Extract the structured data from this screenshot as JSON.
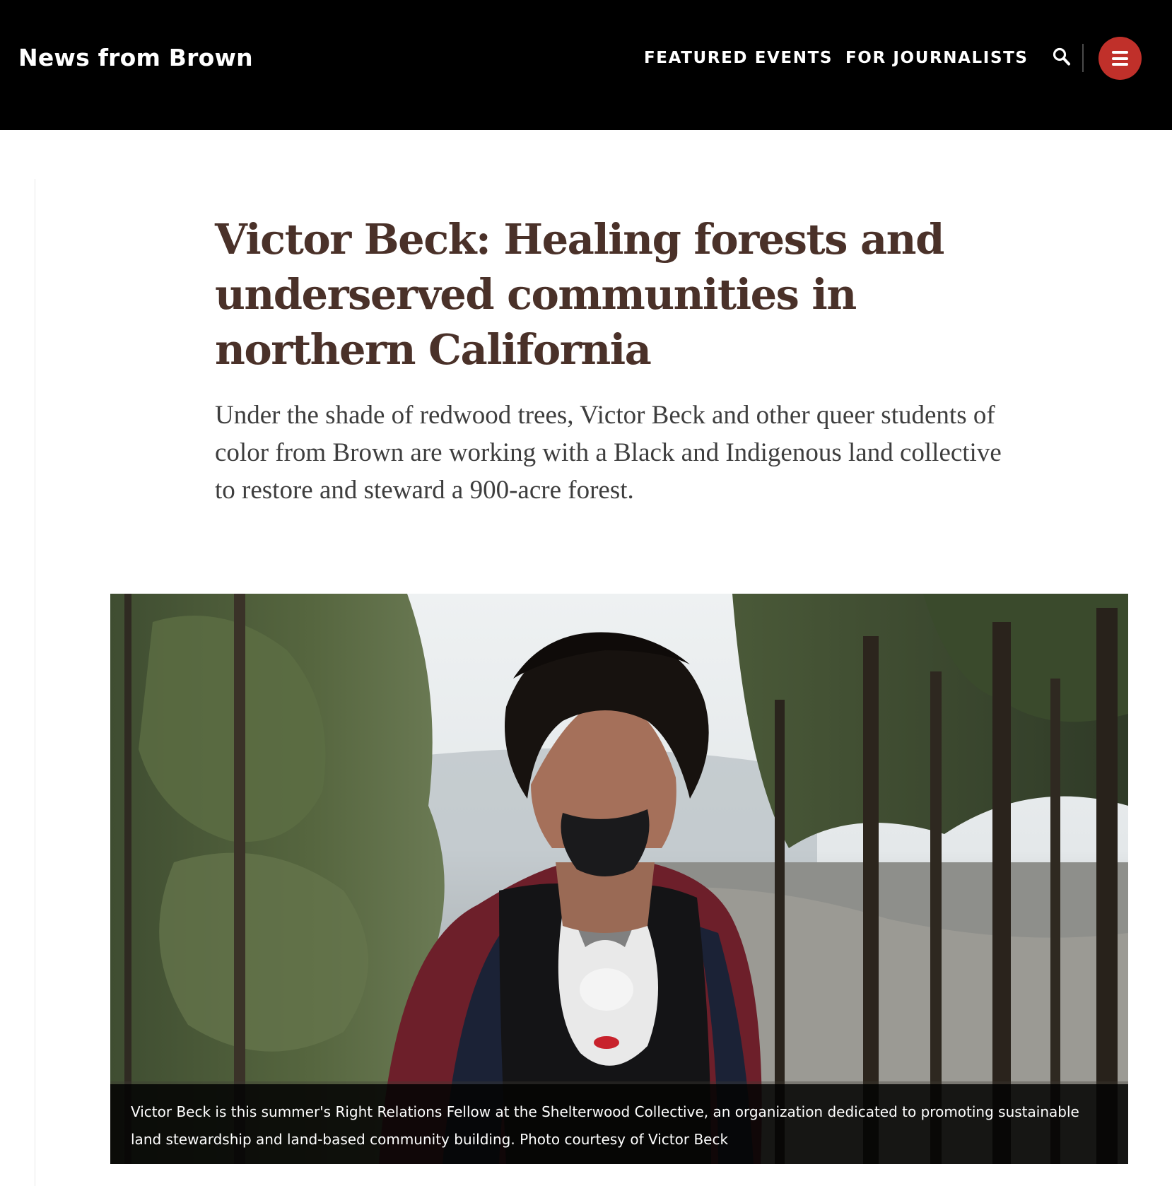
{
  "header": {
    "brand": "News from Brown",
    "nav": [
      {
        "label": "FEATURED EVENTS"
      },
      {
        "label": "FOR JOURNALISTS"
      }
    ],
    "icons": [
      "search-icon",
      "menu-icon"
    ],
    "colors": {
      "background": "#000000",
      "menu_button": "#c0302a"
    }
  },
  "article": {
    "title": "Victor Beck: Healing forests and underserved communities in northern California",
    "dek": "Under the shade of redwood trees, Victor Beck and other queer students of color from Brown are working with a Black and Indigenous land collective to restore and steward a 900-acre forest.",
    "title_color": "#4a3129",
    "figure": {
      "caption": "Victor Beck is this summer's Right Relations Fellow at the Shelterwood Collective, an organization dedicated to promoting sustainable land stewardship and land-based community building. Photo courtesy of Victor Beck"
    }
  }
}
